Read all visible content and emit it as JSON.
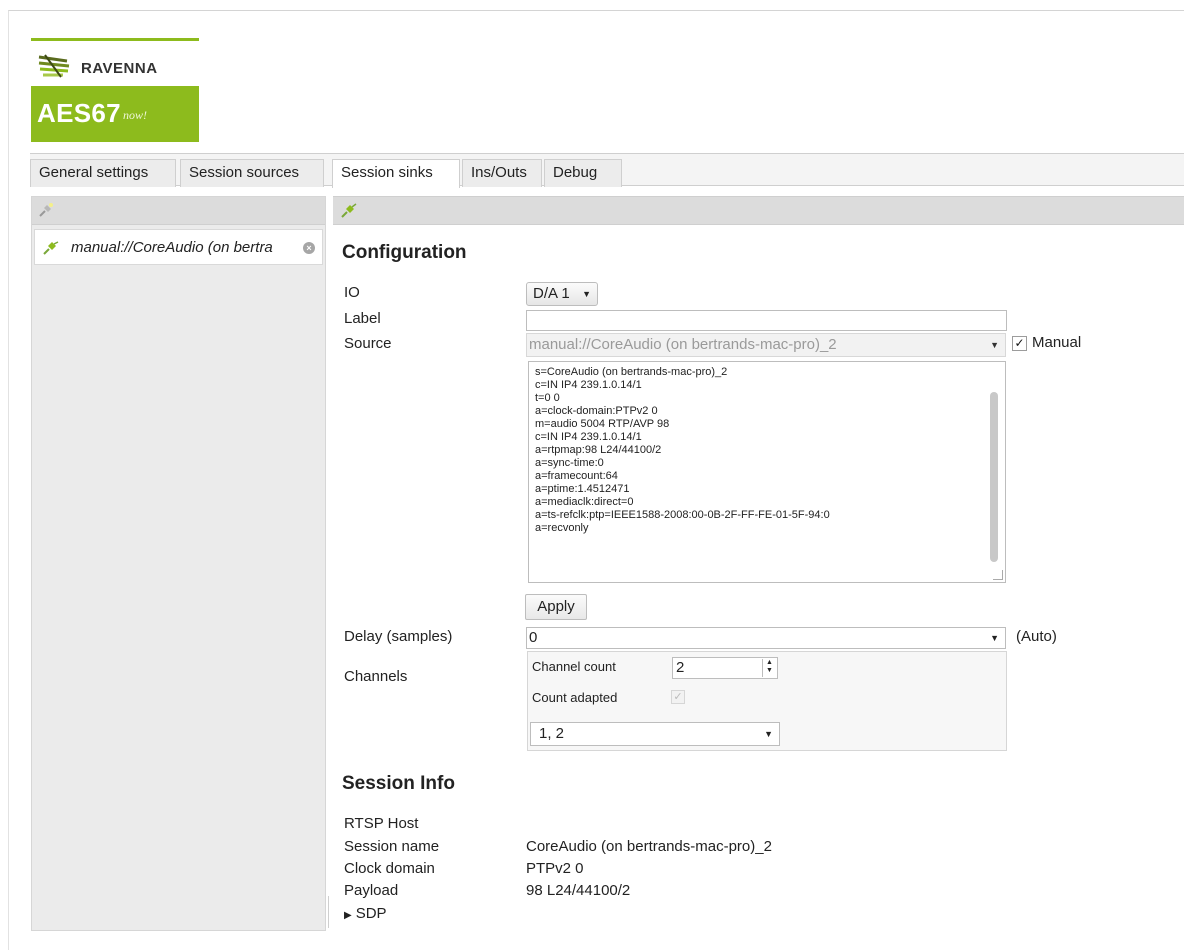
{
  "logo": {
    "brand": "RAVENNA",
    "product": "AES67",
    "tagline": "now!"
  },
  "tabs": [
    {
      "label": "General settings"
    },
    {
      "label": "Session sources"
    },
    {
      "label": "Session sinks",
      "active": true
    },
    {
      "label": "Ins/Outs"
    },
    {
      "label": "Debug"
    }
  ],
  "sinks": [
    {
      "label": "manual://CoreAudio (on bertra"
    }
  ],
  "configuration": {
    "title": "Configuration",
    "io": {
      "label": "IO",
      "value": "D/A 1"
    },
    "label_field": {
      "label": "Label",
      "value": ""
    },
    "source": {
      "label": "Source",
      "value": "manual://CoreAudio (on bertrands-mac-pro)_2",
      "manual_label": "Manual",
      "manual_checked": true
    },
    "sdp_lines": [
      "s=CoreAudio (on bertrands-mac-pro)_2",
      "c=IN IP4 239.1.0.14/1",
      "t=0 0",
      "a=clock-domain:PTPv2 0",
      "m=audio 5004 RTP/AVP 98",
      "c=IN IP4 239.1.0.14/1",
      "a=rtpmap:98 L24/44100/2",
      "a=sync-time:0",
      "a=framecount:64",
      "a=ptime:1.4512471",
      "a=mediaclk:direct=0",
      "a=ts-refclk:ptp=IEEE1588-2008:00-0B-2F-FF-FE-01-5F-94:0",
      "a=recvonly"
    ],
    "apply_label": "Apply",
    "delay": {
      "label": "Delay (samples)",
      "value": "0",
      "auto_label": "(Auto)"
    },
    "channels": {
      "label": "Channels",
      "count_label": "Channel count",
      "count_value": "2",
      "adapted_label": "Count adapted",
      "map_value": "1, 2"
    }
  },
  "session_info": {
    "title": "Session Info",
    "rtsp_host": {
      "label": "RTSP Host",
      "value": ""
    },
    "session_name": {
      "label": "Session name",
      "value": "CoreAudio (on bertrands-mac-pro)_2"
    },
    "clock_domain": {
      "label": "Clock domain",
      "value": "PTPv2 0"
    },
    "payload": {
      "label": "Payload",
      "value": "98 L24/44100/2"
    },
    "sdp_toggle": "SDP"
  },
  "icons": {
    "plug": "plug-icon",
    "remove": "remove-icon",
    "arrow": "dropdown-arrow-icon"
  },
  "colors": {
    "brand_green": "#8dbb1d",
    "panel_bg": "#ebebeb",
    "header_bg": "#dcdcdc"
  }
}
